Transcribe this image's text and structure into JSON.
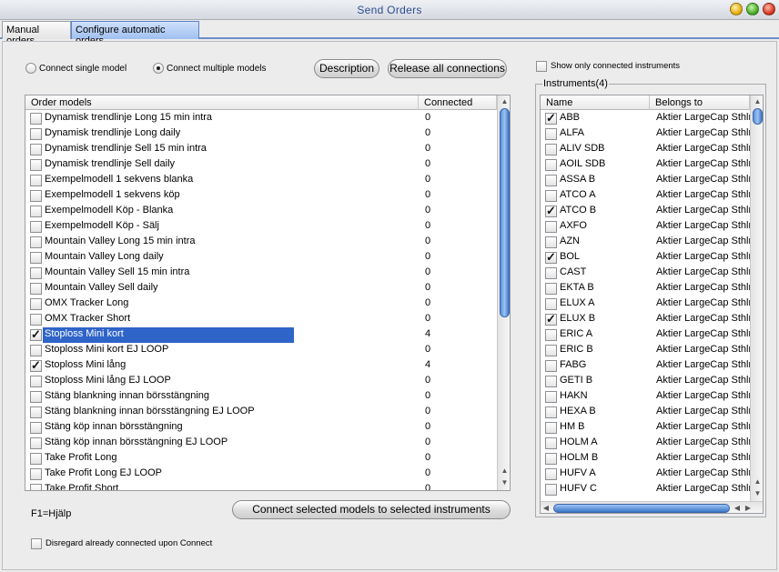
{
  "window": {
    "title": "Send Orders"
  },
  "tabs": [
    {
      "label": "Manual orders"
    },
    {
      "label": "Configure automatic orders"
    }
  ],
  "options": {
    "connect_single": "Connect single model",
    "connect_multiple": "Connect multiple models",
    "description_button": "Description",
    "release_button": "Release all connections",
    "show_only_connected": "Show only connected instruments"
  },
  "models_table": {
    "headers": [
      "Order models",
      "Connected"
    ],
    "rows": [
      {
        "name": "Dynamisk trendlinje Long 15 min intra",
        "connected": "0",
        "checked": false
      },
      {
        "name": "Dynamisk trendlinje Long daily",
        "connected": "0",
        "checked": false
      },
      {
        "name": "Dynamisk trendlinje Sell 15 min intra",
        "connected": "0",
        "checked": false
      },
      {
        "name": "Dynamisk trendlinje Sell daily",
        "connected": "0",
        "checked": false
      },
      {
        "name": "Exempelmodell 1 sekvens blanka",
        "connected": "0",
        "checked": false
      },
      {
        "name": "Exempelmodell 1 sekvens köp",
        "connected": "0",
        "checked": false
      },
      {
        "name": "Exempelmodell Köp - Blanka",
        "connected": "0",
        "checked": false
      },
      {
        "name": "Exempelmodell Köp - Sälj",
        "connected": "0",
        "checked": false
      },
      {
        "name": "Mountain Valley Long 15 min intra",
        "connected": "0",
        "checked": false
      },
      {
        "name": "Mountain Valley Long daily",
        "connected": "0",
        "checked": false
      },
      {
        "name": "Mountain Valley Sell 15 min intra",
        "connected": "0",
        "checked": false
      },
      {
        "name": "Mountain Valley Sell daily",
        "connected": "0",
        "checked": false
      },
      {
        "name": "OMX Tracker Long",
        "connected": "0",
        "checked": false
      },
      {
        "name": "OMX Tracker Short",
        "connected": "0",
        "checked": false
      },
      {
        "name": "Stoploss Mini kort",
        "connected": "4",
        "checked": true,
        "selected": true
      },
      {
        "name": "Stoploss Mini kort EJ LOOP",
        "connected": "0",
        "checked": false
      },
      {
        "name": "Stoploss Mini lång",
        "connected": "4",
        "checked": true
      },
      {
        "name": "Stoploss Mini lång EJ LOOP",
        "connected": "0",
        "checked": false
      },
      {
        "name": "Stäng blankning innan börsstängning",
        "connected": "0",
        "checked": false
      },
      {
        "name": "Stäng blankning innan börsstängning EJ LOOP",
        "connected": "0",
        "checked": false
      },
      {
        "name": "Stäng köp innan börsstängning",
        "connected": "0",
        "checked": false
      },
      {
        "name": "Stäng köp innan börsstängning EJ LOOP",
        "connected": "0",
        "checked": false
      },
      {
        "name": "Take Profit Long",
        "connected": "0",
        "checked": false
      },
      {
        "name": "Take Profit Long EJ LOOP",
        "connected": "0",
        "checked": false
      },
      {
        "name": "Take Profit Short",
        "connected": "0",
        "checked": false
      }
    ]
  },
  "help_text": "F1=Hjälp",
  "connect_button": "Connect selected models to selected instruments",
  "disregard_label": "Disregard already connected upon Connect",
  "instruments": {
    "legend": "Instruments(4)",
    "headers": [
      "Name",
      "Belongs to"
    ],
    "rows": [
      {
        "name": "ABB",
        "belongs": "Aktier LargeCap Sthlm",
        "checked": true
      },
      {
        "name": "ALFA",
        "belongs": "Aktier LargeCap Sthlm",
        "checked": false
      },
      {
        "name": "ALIV SDB",
        "belongs": "Aktier LargeCap Sthlm",
        "checked": false
      },
      {
        "name": "AOIL SDB",
        "belongs": "Aktier LargeCap Sthlm",
        "checked": false
      },
      {
        "name": "ASSA B",
        "belongs": "Aktier LargeCap Sthlm",
        "checked": false
      },
      {
        "name": "ATCO A",
        "belongs": "Aktier LargeCap Sthlm",
        "checked": false
      },
      {
        "name": "ATCO B",
        "belongs": "Aktier LargeCap Sthlm",
        "checked": true
      },
      {
        "name": "AXFO",
        "belongs": "Aktier LargeCap Sthlm",
        "checked": false
      },
      {
        "name": "AZN",
        "belongs": "Aktier LargeCap Sthlm",
        "checked": false
      },
      {
        "name": "BOL",
        "belongs": "Aktier LargeCap Sthlm",
        "checked": true
      },
      {
        "name": "CAST",
        "belongs": "Aktier LargeCap Sthlm",
        "checked": false
      },
      {
        "name": "EKTA B",
        "belongs": "Aktier LargeCap Sthlm",
        "checked": false
      },
      {
        "name": "ELUX A",
        "belongs": "Aktier LargeCap Sthlm",
        "checked": false
      },
      {
        "name": "ELUX B",
        "belongs": "Aktier LargeCap Sthlm",
        "checked": true
      },
      {
        "name": "ERIC A",
        "belongs": "Aktier LargeCap Sthlm",
        "checked": false
      },
      {
        "name": "ERIC B",
        "belongs": "Aktier LargeCap Sthlm",
        "checked": false
      },
      {
        "name": "FABG",
        "belongs": "Aktier LargeCap Sthlm",
        "checked": false
      },
      {
        "name": "GETI B",
        "belongs": "Aktier LargeCap Sthlm",
        "checked": false
      },
      {
        "name": "HAKN",
        "belongs": "Aktier LargeCap Sthlm",
        "checked": false
      },
      {
        "name": "HEXA B",
        "belongs": "Aktier LargeCap Sthlm",
        "checked": false
      },
      {
        "name": "HM B",
        "belongs": "Aktier LargeCap Sthlm",
        "checked": false
      },
      {
        "name": "HOLM A",
        "belongs": "Aktier LargeCap Sthlm",
        "checked": false
      },
      {
        "name": "HOLM B",
        "belongs": "Aktier LargeCap Sthlm",
        "checked": false
      },
      {
        "name": "HUFV A",
        "belongs": "Aktier LargeCap Sthlm",
        "checked": false
      },
      {
        "name": "HUFV C",
        "belongs": "Aktier LargeCap Sthlm",
        "checked": false
      }
    ]
  }
}
